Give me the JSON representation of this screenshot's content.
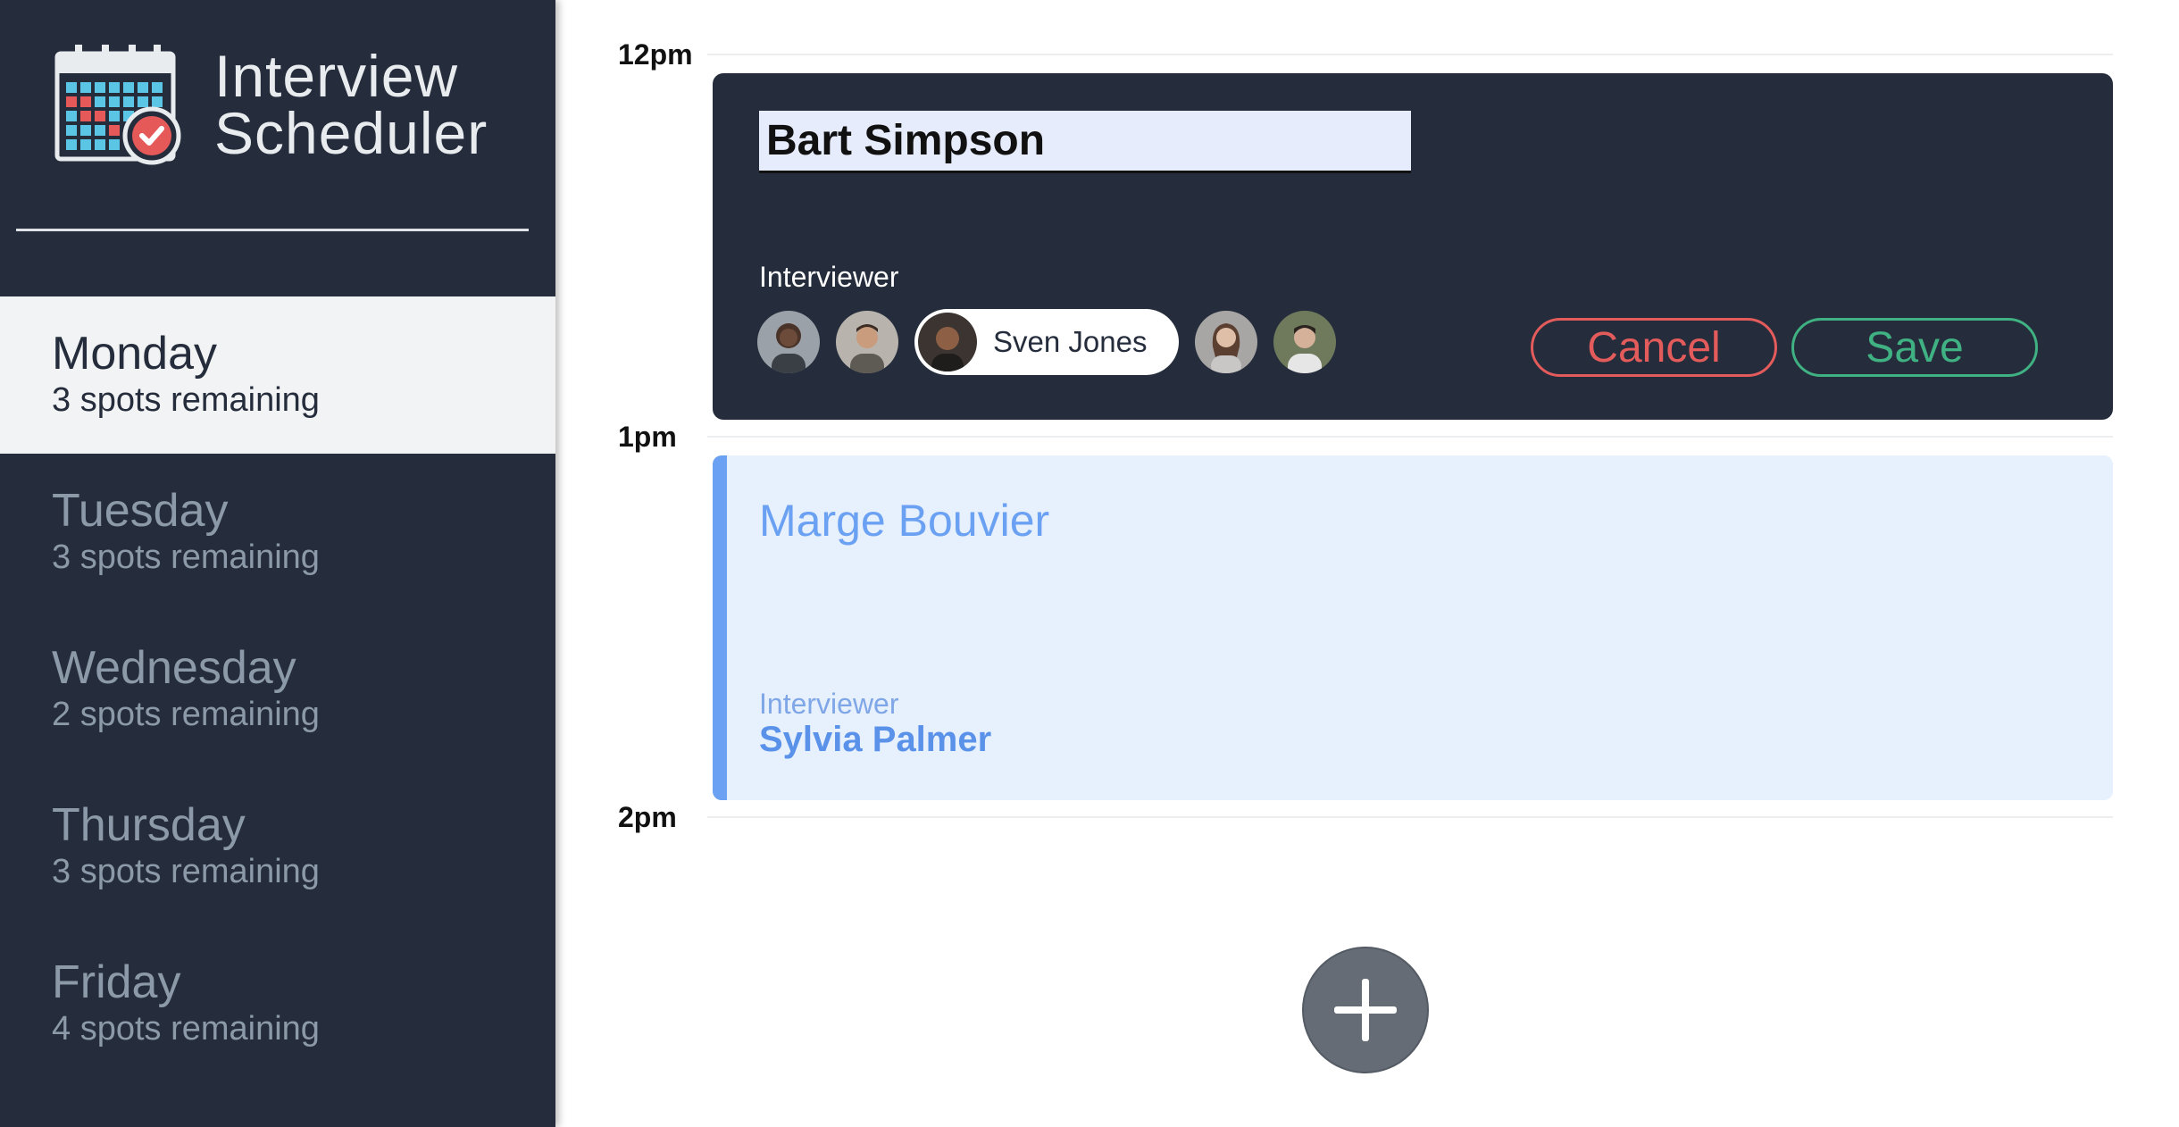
{
  "app": {
    "title_line1": "Interview",
    "title_line2": "Scheduler"
  },
  "sidebar": {
    "days": [
      {
        "name": "Monday",
        "spots": "3 spots remaining",
        "selected": true
      },
      {
        "name": "Tuesday",
        "spots": "3 spots remaining",
        "selected": false
      },
      {
        "name": "Wednesday",
        "spots": "2 spots remaining",
        "selected": false
      },
      {
        "name": "Thursday",
        "spots": "3 spots remaining",
        "selected": false
      },
      {
        "name": "Friday",
        "spots": "4 spots remaining",
        "selected": false
      }
    ]
  },
  "schedule": {
    "times": [
      "12pm",
      "1pm",
      "2pm"
    ],
    "edit_form": {
      "student_name": "Bart Simpson",
      "interviewer_heading": "Interviewer",
      "selected_interviewer": "Sven Jones",
      "cancel_label": "Cancel",
      "save_label": "Save"
    },
    "appointment": {
      "student_name": "Marge Bouvier",
      "interviewer_heading": "Interviewer",
      "interviewer_name": "Sylvia Palmer"
    }
  },
  "icons": {
    "logo": "calendar-check-icon",
    "add": "plus-icon",
    "avatars": [
      "avatar-icon",
      "avatar-icon",
      "avatar-icon",
      "avatar-icon",
      "avatar-icon"
    ]
  },
  "colors": {
    "sidebar_bg": "#252d3c",
    "selected_day_bg": "#f2f3f4",
    "cancel": "#e35b5b",
    "save": "#3fb182",
    "appointment_accent": "#6ba1f2",
    "appointment_bg": "#e7f0fd",
    "add_button": "#656c76"
  }
}
